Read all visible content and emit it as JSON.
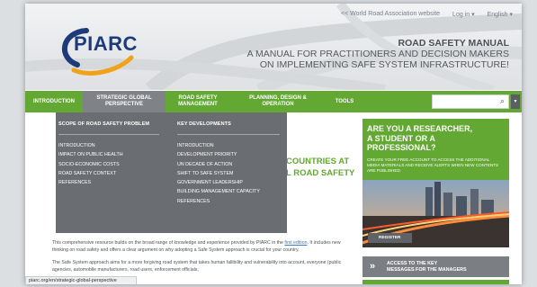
{
  "header": {
    "top_links": [
      "<< World Road Association website",
      "Log in ▾",
      "English ▾"
    ],
    "logo_text": "PIARC",
    "manual_title": [
      "ROAD SAFETY MANUAL",
      "A MANUAL FOR PRACTITIONERS AND DECISION MAKERS",
      "ON IMPLEMENTING SAFE SYSTEM INFRASTRUCTURE!"
    ]
  },
  "nav": {
    "items": [
      "INTRODUCTION",
      "STRATEGIC GLOBAL PERSPECTIVE",
      "ROAD SAFETY MANAGEMENT",
      "PLANNING, DESIGN & OPERATION",
      "TOOLS"
    ],
    "active_index": 1,
    "search_placeholder": ""
  },
  "mega_menu": {
    "col1": {
      "heading": "SCOPE OF ROAD SAFETY PROBLEM",
      "items": [
        "INTRODUCTION",
        "IMPACT ON PUBLIC HEALTH",
        "SOCIO-ECONOMIC COSTS",
        "ROAD SAFETY CONTEXT",
        "REFERENCES"
      ]
    },
    "col2": {
      "heading": "KEY DEVELOPMENTS",
      "items": [
        "INTRODUCTION",
        "DEVELOPMENT PRIORITY",
        "UN DECADE OF ACTION",
        "SHIFT TO SAFE SYSTEM",
        "GOVERNMENT LEADERSHIP",
        "BUILDING MANAGEMENT CAPACITY",
        "REFERENCES"
      ]
    }
  },
  "main": {
    "headline": [
      "COUNTRIES AT",
      "L ROAD SAFETY"
    ],
    "body": [
      "This comprehensive resource builds on the broad range of knowledge and experience provided by PIARC in the ",
      "first edition",
      ". It includes new thinking on road safety and offers a clear argument on why adopting a Safe System approach is crucial for your country.",
      "The Safe System approach aims for a more forgiving road system that takes human fallibility and vulnerability into account, everyone (public agencies, automobile manufacturers, road users, enforcement officials,"
    ]
  },
  "status_bar": "piarc.org/en/strategic-global-perspective",
  "sidebar": {
    "question": [
      "ARE YOU A RESEARCHER,",
      "A STUDENT OR A",
      "PROFESSIONAL?"
    ],
    "desc": "CREATE YOUR FREE ACCOUNT TO ACCESS THE ADDITIONAL MEDIA MATERIALS AND RECEIVE ALERTS WHEN NEW CONTENTS ARE PUBLISHED.",
    "register_label": "REGISTER",
    "access_chevron": "»",
    "access_text": [
      "ACCESS TO THE KEY",
      "MESSAGES FOR THE MANAGERS"
    ]
  },
  "colors": {
    "green": "#62a832",
    "menu_gray": "#6a6e72",
    "logo_blue": "#1d3b7a",
    "logo_orange": "#f0a21a"
  }
}
